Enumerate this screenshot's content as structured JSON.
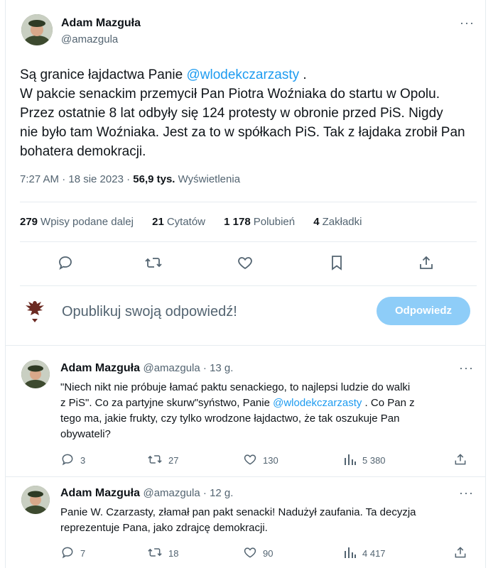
{
  "main_tweet": {
    "author_name": "Adam Mazguła",
    "author_handle": "@amazgula",
    "text_lines": [
      {
        "before": "Są granice łajdactwa Panie ",
        "mention": "@wlodekczarzasty",
        "after": " ."
      },
      {
        "before": "W pakcie senackim przemycił Pan Piotra Woźniaka do startu w Opolu.",
        "mention": "",
        "after": ""
      },
      {
        "before": "Przez ostatnie 8 lat odbyły się 124 protesty w obronie przed PiS. Nigdy",
        "mention": "",
        "after": ""
      },
      {
        "before": "nie było tam Woźniaka. Jest za to w spółkach PiS. Tak z łajdaka zrobił Pan",
        "mention": "",
        "after": ""
      },
      {
        "before": "bohatera demokracji.",
        "mention": "",
        "after": ""
      }
    ],
    "time": "7:27 AM · 18 sie 2023 · ",
    "views_count": "56,9 tys.",
    "views_label": " Wyświetlenia",
    "stats": {
      "reposts_count": "279",
      "reposts_label": "Wpisy podane dalej",
      "quotes_count": "21",
      "quotes_label": "Cytatów",
      "likes_count": "1 178",
      "likes_label": "Polubień",
      "bookmarks_count": "4",
      "bookmarks_label": "Zakładki"
    }
  },
  "reply_composer": {
    "placeholder": "Opublikuj swoją odpowiedź!",
    "button_label": "Odpowiedz"
  },
  "replies": [
    {
      "author_name": "Adam Mazguła",
      "author_handle": "@amazgula · 13 g.",
      "lines": [
        {
          "before": "\"Niech nikt nie próbuje łamać paktu senackiego, to najlepsi ludzie do walki",
          "mention": "",
          "after": ""
        },
        {
          "before": "z PiS\". Co za partyjne skurw\"syństwo, Panie ",
          "mention": "@wlodekczarzasty",
          "after": " . Co Pan z"
        },
        {
          "before": "tego ma, jakie frukty, czy tylko wrodzone łajdactwo, że tak oszukuje Pan",
          "mention": "",
          "after": ""
        },
        {
          "before": "obywateli?",
          "mention": "",
          "after": ""
        }
      ],
      "replies": "3",
      "reposts": "27",
      "likes": "130",
      "views": "5 380"
    },
    {
      "author_name": "Adam Mazguła",
      "author_handle": "@amazgula · 12 g.",
      "lines": [
        {
          "before": "Panie W. Czarzasty, złamał pan pakt senacki! Nadużył zaufania. Ta decyzja",
          "mention": "",
          "after": ""
        },
        {
          "before": "reprezentuje Pana, jako zdrajcę demokracji.",
          "mention": "",
          "after": ""
        }
      ],
      "replies": "7",
      "reposts": "18",
      "likes": "90",
      "views": "4 417"
    }
  ],
  "colors": {
    "accent": "#1d9bf0",
    "secondary_text": "#536471",
    "reply_button": "#8ecdf8"
  }
}
